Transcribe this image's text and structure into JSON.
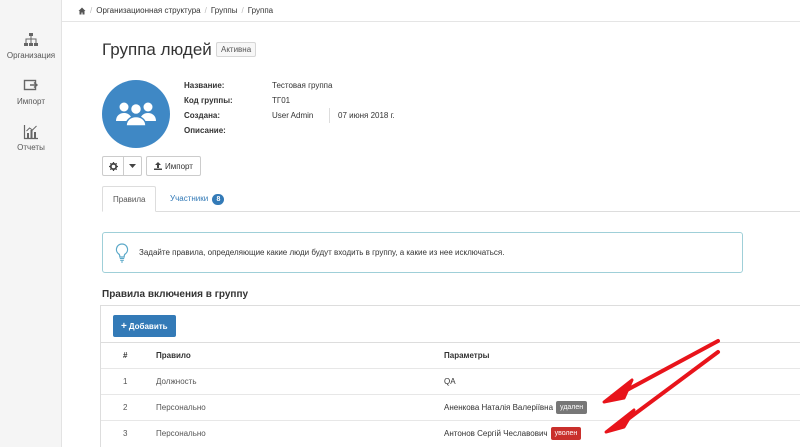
{
  "sidebar": {
    "items": [
      {
        "label": "Организация",
        "icon": "org-tree-icon"
      },
      {
        "label": "Импорт",
        "icon": "import-icon"
      },
      {
        "label": "Отчеты",
        "icon": "chart-icon"
      }
    ]
  },
  "breadcrumb": {
    "items": [
      "Организационная структура",
      "Группы",
      "Группа"
    ]
  },
  "page": {
    "title": "Группа людей",
    "status": "Активна"
  },
  "info": {
    "name_label": "Название:",
    "name_value": "Тестовая группа",
    "code_label": "Код группы:",
    "code_value": "ТГ01",
    "created_label": "Создана:",
    "created_by": "User Admin",
    "created_date": "07 июня 2018 г.",
    "desc_label": "Описание:"
  },
  "toolbar": {
    "import_label": "Импорт"
  },
  "tabs": {
    "rules": "Правила",
    "members": "Участники",
    "members_count": "8"
  },
  "notice": {
    "text": "Задайте правила, определяющие какие люди будут входить в группу, а какие из нее исключаться."
  },
  "inclusion": {
    "title": "Правила включения в группу",
    "add_label": "Добавить",
    "columns": {
      "num": "#",
      "rule": "Правило",
      "params": "Параметры"
    },
    "rows": [
      {
        "num": "1",
        "rule": "Должность",
        "params": "QA",
        "badge": ""
      },
      {
        "num": "2",
        "rule": "Персонально",
        "params": "Аненкова Наталія Валеріївна",
        "badge": "удален"
      },
      {
        "num": "3",
        "rule": "Персонально",
        "params": "Антонов Сергій Чеславович",
        "badge": "уволен"
      }
    ]
  },
  "colors": {
    "primary": "#337ab7",
    "avatar": "#3f88c5",
    "badge_removed": "#777777",
    "badge_fired": "#c9302c",
    "arrow": "#e8141b"
  }
}
